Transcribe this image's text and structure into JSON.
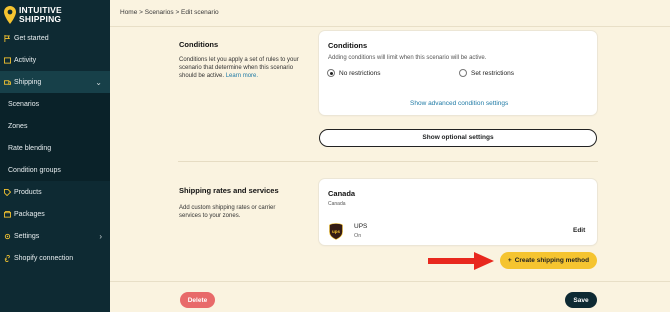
{
  "brand": {
    "line1": "INTUITIVE",
    "line2": "SHIPPING",
    "logo_icon": "map-pin-icon",
    "accent": "#f5c430"
  },
  "sidebar": {
    "items": [
      {
        "label": "Get started",
        "icon": "flag-icon"
      },
      {
        "label": "Activity",
        "icon": "activity-icon"
      },
      {
        "label": "Shipping",
        "icon": "truck-icon",
        "chevron": "⌄"
      },
      {
        "label": "Scenarios"
      },
      {
        "label": "Zones"
      },
      {
        "label": "Rate blending"
      },
      {
        "label": "Condition groups"
      },
      {
        "label": "Products",
        "icon": "tag-icon"
      },
      {
        "label": "Packages",
        "icon": "box-icon"
      },
      {
        "label": "Settings",
        "icon": "gear-icon",
        "chevron": "›"
      },
      {
        "label": "Shopify connection",
        "icon": "link-icon"
      }
    ]
  },
  "breadcrumb": "Home > Scenarios > Edit scenario",
  "conditions": {
    "heading": "Conditions",
    "description": "Conditions let you apply a set of rules to your scenario that determine when this scenario should be active.",
    "learn_more": "Learn more.",
    "card_title": "Conditions",
    "card_sub": "Adding conditions will limit when this scenario will be active.",
    "option_no_restrictions": "No restrictions",
    "option_set_restrictions": "Set restrictions",
    "advanced_link": "Show advanced condition settings"
  },
  "optional_settings_label": "Show optional settings",
  "rates": {
    "heading": "Shipping rates and services",
    "description": "Add custom shipping rates or carrier services to your zones.",
    "zone_title": "Canada",
    "zone_sub": "Canada",
    "carrier_name": "UPS",
    "carrier_status": "On",
    "edit_label": "Edit",
    "create_label": "Create shipping method",
    "create_icon": "+"
  },
  "footer": {
    "delete_label": "Delete",
    "save_label": "Save"
  },
  "colors": {
    "sidebar": "#0e2a33",
    "page_bg": "#faf3e0",
    "delete": "#e86a6a",
    "arrow": "#e8281e"
  }
}
